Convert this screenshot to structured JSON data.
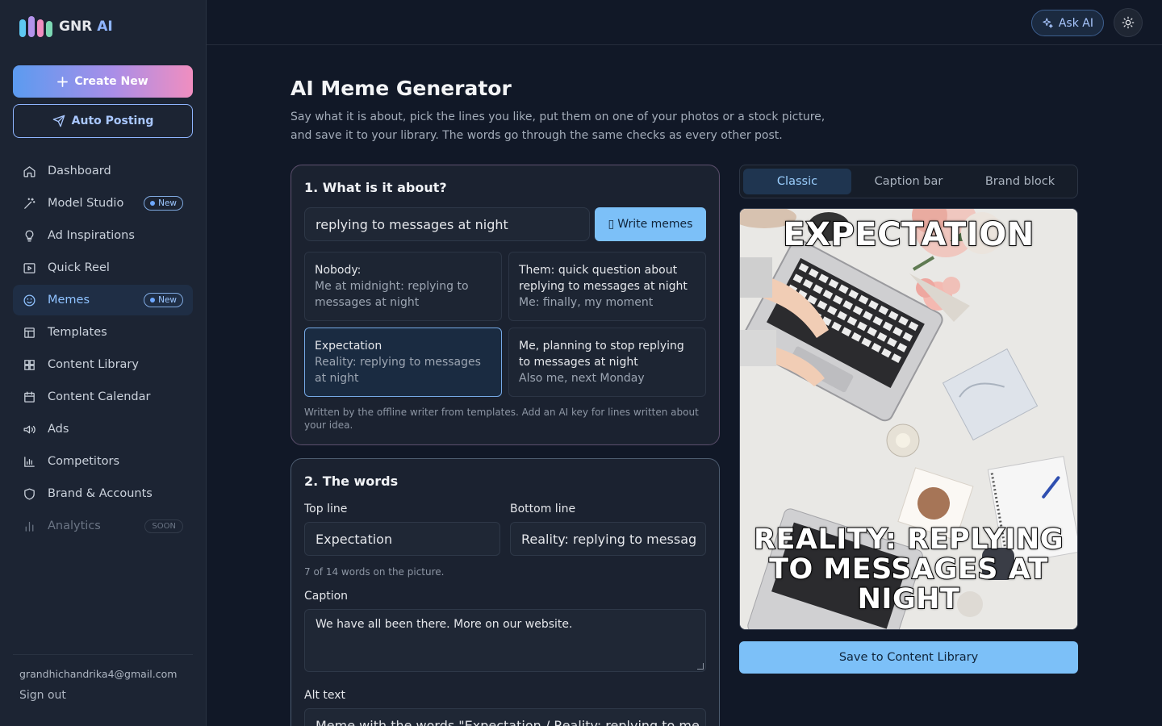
{
  "brand": {
    "name": "GNR",
    "suffix": "AI"
  },
  "sidebar": {
    "create_label": "Create New",
    "auto_label": "Auto Posting",
    "items": [
      {
        "label": "Dashboard",
        "icon": "home-icon"
      },
      {
        "label": "Model Studio",
        "icon": "wand-icon",
        "badge": "New"
      },
      {
        "label": "Ad Inspirations",
        "icon": "lightbulb-icon"
      },
      {
        "label": "Quick Reel",
        "icon": "play-icon"
      },
      {
        "label": "Memes",
        "icon": "smile-icon",
        "badge": "New",
        "active": true
      },
      {
        "label": "Templates",
        "icon": "layout-icon"
      },
      {
        "label": "Content Library",
        "icon": "grid-icon"
      },
      {
        "label": "Content Calendar",
        "icon": "calendar-icon"
      },
      {
        "label": "Ads",
        "icon": "megaphone-icon"
      },
      {
        "label": "Competitors",
        "icon": "bar-chart-icon"
      },
      {
        "label": "Brand & Accounts",
        "icon": "shield-icon"
      },
      {
        "label": "Analytics",
        "icon": "analytics-icon",
        "badge": "SOON"
      }
    ],
    "email": "grandhichandrika4@gmail.com",
    "signout": "Sign out"
  },
  "topbar": {
    "ask_ai": "Ask AI"
  },
  "page": {
    "title": "AI Meme Generator",
    "description": "Say what it is about, pick the lines you like, put them on one of your photos or a stock picture, and save it to your library. The words go through the same checks as every other post."
  },
  "step1": {
    "title": "1. What is it about?",
    "topic": "replying to messages at night",
    "write_label": "Write memes",
    "suggestions": [
      {
        "line1": "Nobody:",
        "line2": "Me at midnight: replying to messages at night"
      },
      {
        "line1": "Them: quick question about replying to messages at night",
        "line2": "Me: finally, my moment"
      },
      {
        "line1": "Expectation",
        "line2": "Reality: replying to messages at night"
      },
      {
        "line1": "Me, planning to stop replying to messages at night",
        "line2": "Also me, next Monday"
      }
    ],
    "hint": "Written by the offline writer from templates. Add an AI key for lines written about your idea."
  },
  "step2": {
    "title": "2. The words",
    "top_label": "Top line",
    "top_value": "Expectation",
    "bottom_label": "Bottom line",
    "bottom_value": "Reality: replying to messag",
    "word_count": "7 of 14 words on the picture.",
    "caption_label": "Caption",
    "caption_value": "We have all been there. More on our website.",
    "alt_label": "Alt text",
    "alt_value": "Meme with the words \"Expectation / Reality: replying to me"
  },
  "preview": {
    "tabs": [
      "Classic",
      "Caption bar",
      "Brand block"
    ],
    "active_tab": "Classic",
    "top_text": "Expectation",
    "bottom_text": "Reality: replying to messages at night",
    "save_label": "Save to Content Library"
  },
  "colors": {
    "accent": "#7cc0f8",
    "active_nav": "#8fc2ff",
    "background": "#111827"
  }
}
